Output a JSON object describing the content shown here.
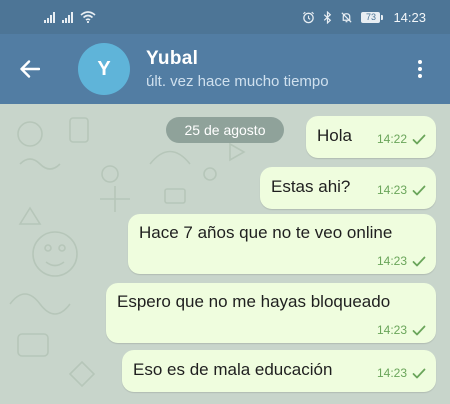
{
  "status_bar": {
    "time": "14:23",
    "battery": "73",
    "icons": [
      "signal-icon",
      "signal-icon",
      "wifi-icon",
      "alarm-icon",
      "bluetooth-icon",
      "mute-icon",
      "battery-icon"
    ]
  },
  "header": {
    "avatar_initial": "Y",
    "contact_name": "Yubal",
    "last_seen": "últ. vez hace mucho tiempo",
    "colors": {
      "bar": "#527da3",
      "status_bar": "#4d7596",
      "avatar": "#5fb4d9"
    }
  },
  "chat": {
    "date_label": "25 de agosto",
    "messages": [
      {
        "text": "Hola",
        "time": "14:22",
        "status": "sent-check-icon"
      },
      {
        "text": "Estas ahi?",
        "time": "14:23",
        "status": "sent-check-icon"
      },
      {
        "text": "Hace 7 años que no te veo online",
        "time": "14:23",
        "status": "sent-check-icon"
      },
      {
        "text": "Espero que no me hayas bloqueado",
        "time": "14:23",
        "status": "sent-check-icon"
      },
      {
        "text": "Eso es de mala educación",
        "time": "14:23",
        "status": "sent-check-icon"
      }
    ],
    "colors": {
      "bubble_out": "#effdde",
      "tick": "#6aa55a",
      "background": "#c8d5cb"
    }
  }
}
